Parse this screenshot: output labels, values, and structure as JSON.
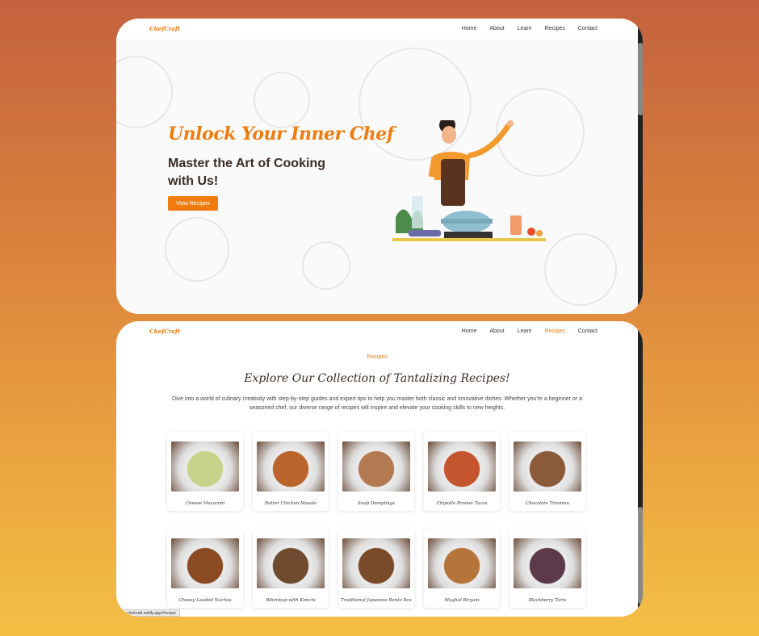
{
  "brand": "ChefCraft",
  "nav": [
    "Home",
    "About",
    "Learn",
    "Recipes",
    "Contact"
  ],
  "hero": {
    "title": "Unlock Your Inner Chef",
    "subtitle": "Master the Art of Cooking with Us!",
    "button": "View Recipes"
  },
  "recipes": {
    "eyebrow": "Recipes",
    "title": "Explore Our Collection of Tantalizing Recipes!",
    "description": "Dive into a world of culinary creativity with step-by-step guides and expert tips to help you master both classic and innovative dishes. Whether you're a beginner or a seasoned chef, our diverse range of recipes will inspire and elevate your cooking skills to new heights.",
    "items": [
      {
        "name": "Cheese Macaroni",
        "color": "#c9d28a"
      },
      {
        "name": "Butter Chicken Masala",
        "color": "#b8642a"
      },
      {
        "name": "Soup Dumplings",
        "color": "#b37a52"
      },
      {
        "name": "Chipotle Brisket Tacos",
        "color": "#c4552f"
      },
      {
        "name": "Chocolate Tiramisu",
        "color": "#8a5a3a"
      },
      {
        "name": "Cheesy Loaded Nachos",
        "color": "#8a4a22"
      },
      {
        "name": "Bibimbap with Kimchi",
        "color": "#6e4a2e"
      },
      {
        "name": "Traditional Japanese Bento Box",
        "color": "#7a4b2a"
      },
      {
        "name": "Mughal Biryani",
        "color": "#b5743a"
      },
      {
        "name": "Blackberry Tarts",
        "color": "#5c3a4a"
      }
    ]
  },
  "status_url": "chefcraft.netlify.app/#recipe"
}
